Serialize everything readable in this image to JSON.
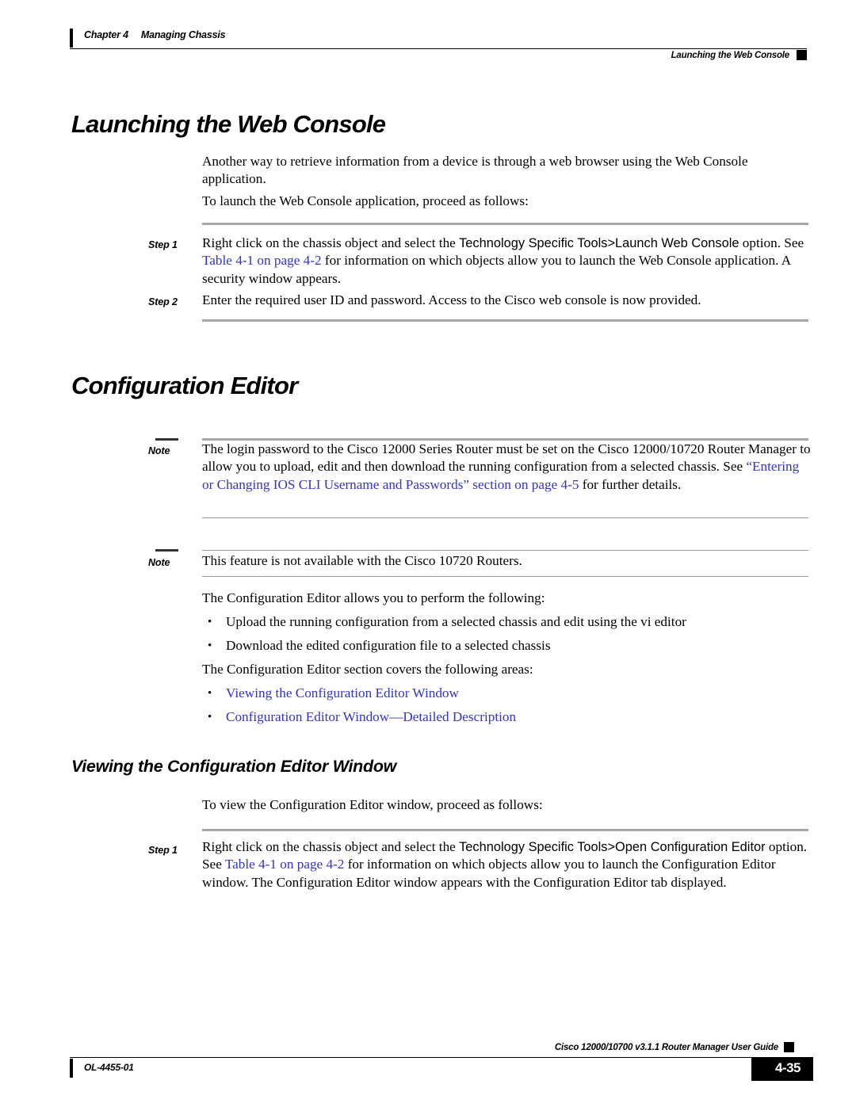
{
  "header": {
    "chapter_number": "Chapter 4",
    "chapter_title": "Managing Chassis",
    "running_head": "Launching the Web Console"
  },
  "sections": {
    "launching": {
      "heading": "Launching the Web Console",
      "intro_paragraph": "Another way to retrieve information from a device is through a web browser using the Web Console application.",
      "lead_in": "To launch the Web Console application, proceed as follows:",
      "step1": {
        "label": "Step 1",
        "text_a": "Right click on the chassis object and select the ",
        "menu_path": "Technology Specific Tools>Launch Web Console",
        "text_b": " option. See ",
        "link": "Table 4-1 on page 4-2",
        "text_c": " for information on which objects allow you to launch the Web Console application. A security window appears."
      },
      "step2": {
        "label": "Step 2",
        "text": "Enter the required user ID and password. Access to the Cisco web console is now provided."
      }
    },
    "config_editor": {
      "heading": "Configuration Editor",
      "note1": {
        "label": "Note",
        "text_a": "The login password to the Cisco 12000 Series Router must be set on the Cisco 12000/10720 Router Manager to allow you to upload, edit and then download the running configuration from a selected chassis. See ",
        "link": "“Entering or Changing IOS CLI Username and Passwords” section on page 4-5",
        "text_b": " for further details."
      },
      "note2": {
        "label": "Note",
        "text": "This feature is not available with the Cisco 10720 Routers."
      },
      "allows_lead_in": "The Configuration Editor allows you to perform the following:",
      "allows_bullets": [
        "Upload the running configuration from a selected chassis and edit using the vi editor",
        "Download the edited configuration file to a selected chassis"
      ],
      "covers_lead_in": "The Configuration Editor section covers the following areas:",
      "covers_links": [
        "Viewing the Configuration Editor Window",
        "Configuration Editor Window—Detailed Description"
      ]
    },
    "viewing": {
      "heading": "Viewing the Configuration Editor Window",
      "lead_in": "To view the Configuration Editor window, proceed as follows:",
      "step1": {
        "label": "Step 1",
        "text_a": "Right click on the chassis object and select the ",
        "menu_path": "Technology Specific Tools>Open Configuration Editor",
        "text_b": " option. See ",
        "link": "Table 4-1 on page 4-2",
        "text_c": " for information on which objects allow you to launch the Configuration Editor window. The Configuration Editor window appears with the Configuration Editor tab displayed."
      }
    }
  },
  "footer": {
    "guide_title": "Cisco 12000/10700 v3.1.1 Router Manager User Guide",
    "doc_number": "OL-4455-01",
    "page_number": "4-35"
  },
  "bullet_glyph": "•",
  "colors": {
    "link": "#3333cc",
    "rule_gray": "#a6a6a6",
    "rule_thin": "#999999"
  }
}
